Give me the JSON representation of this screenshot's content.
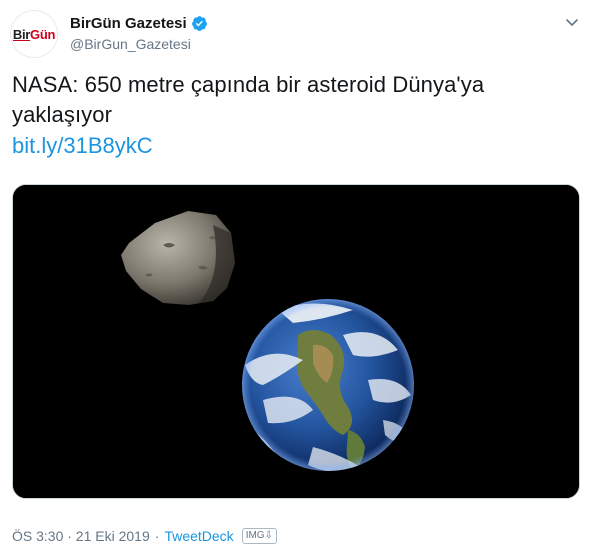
{
  "tweet": {
    "author": {
      "display_name": "BirGün Gazetesi",
      "handle": "@BirGun_Gazetesi",
      "avatar_text_part1": "Bir",
      "avatar_text_part2": "Gün",
      "verified": true
    },
    "text": "NASA: 650 metre çapında bir asteroid Dünya'ya yaklaşıyor",
    "link": "bit.ly/31B8ykC",
    "media": {
      "kind": "photo",
      "background": "#000000"
    },
    "timestamp": "ÖS 3:30 · 21 Eki 2019",
    "separator": "·",
    "source": "TweetDeck",
    "image_badge": "IMG⇩"
  },
  "colors": {
    "link": "#1b95e0",
    "secondary_text": "#657786",
    "brand_red": "#d0021b",
    "verified_blue": "#1da1f2"
  },
  "icons": {
    "verified": "verified-badge-icon",
    "menu": "chevron-down-icon"
  }
}
